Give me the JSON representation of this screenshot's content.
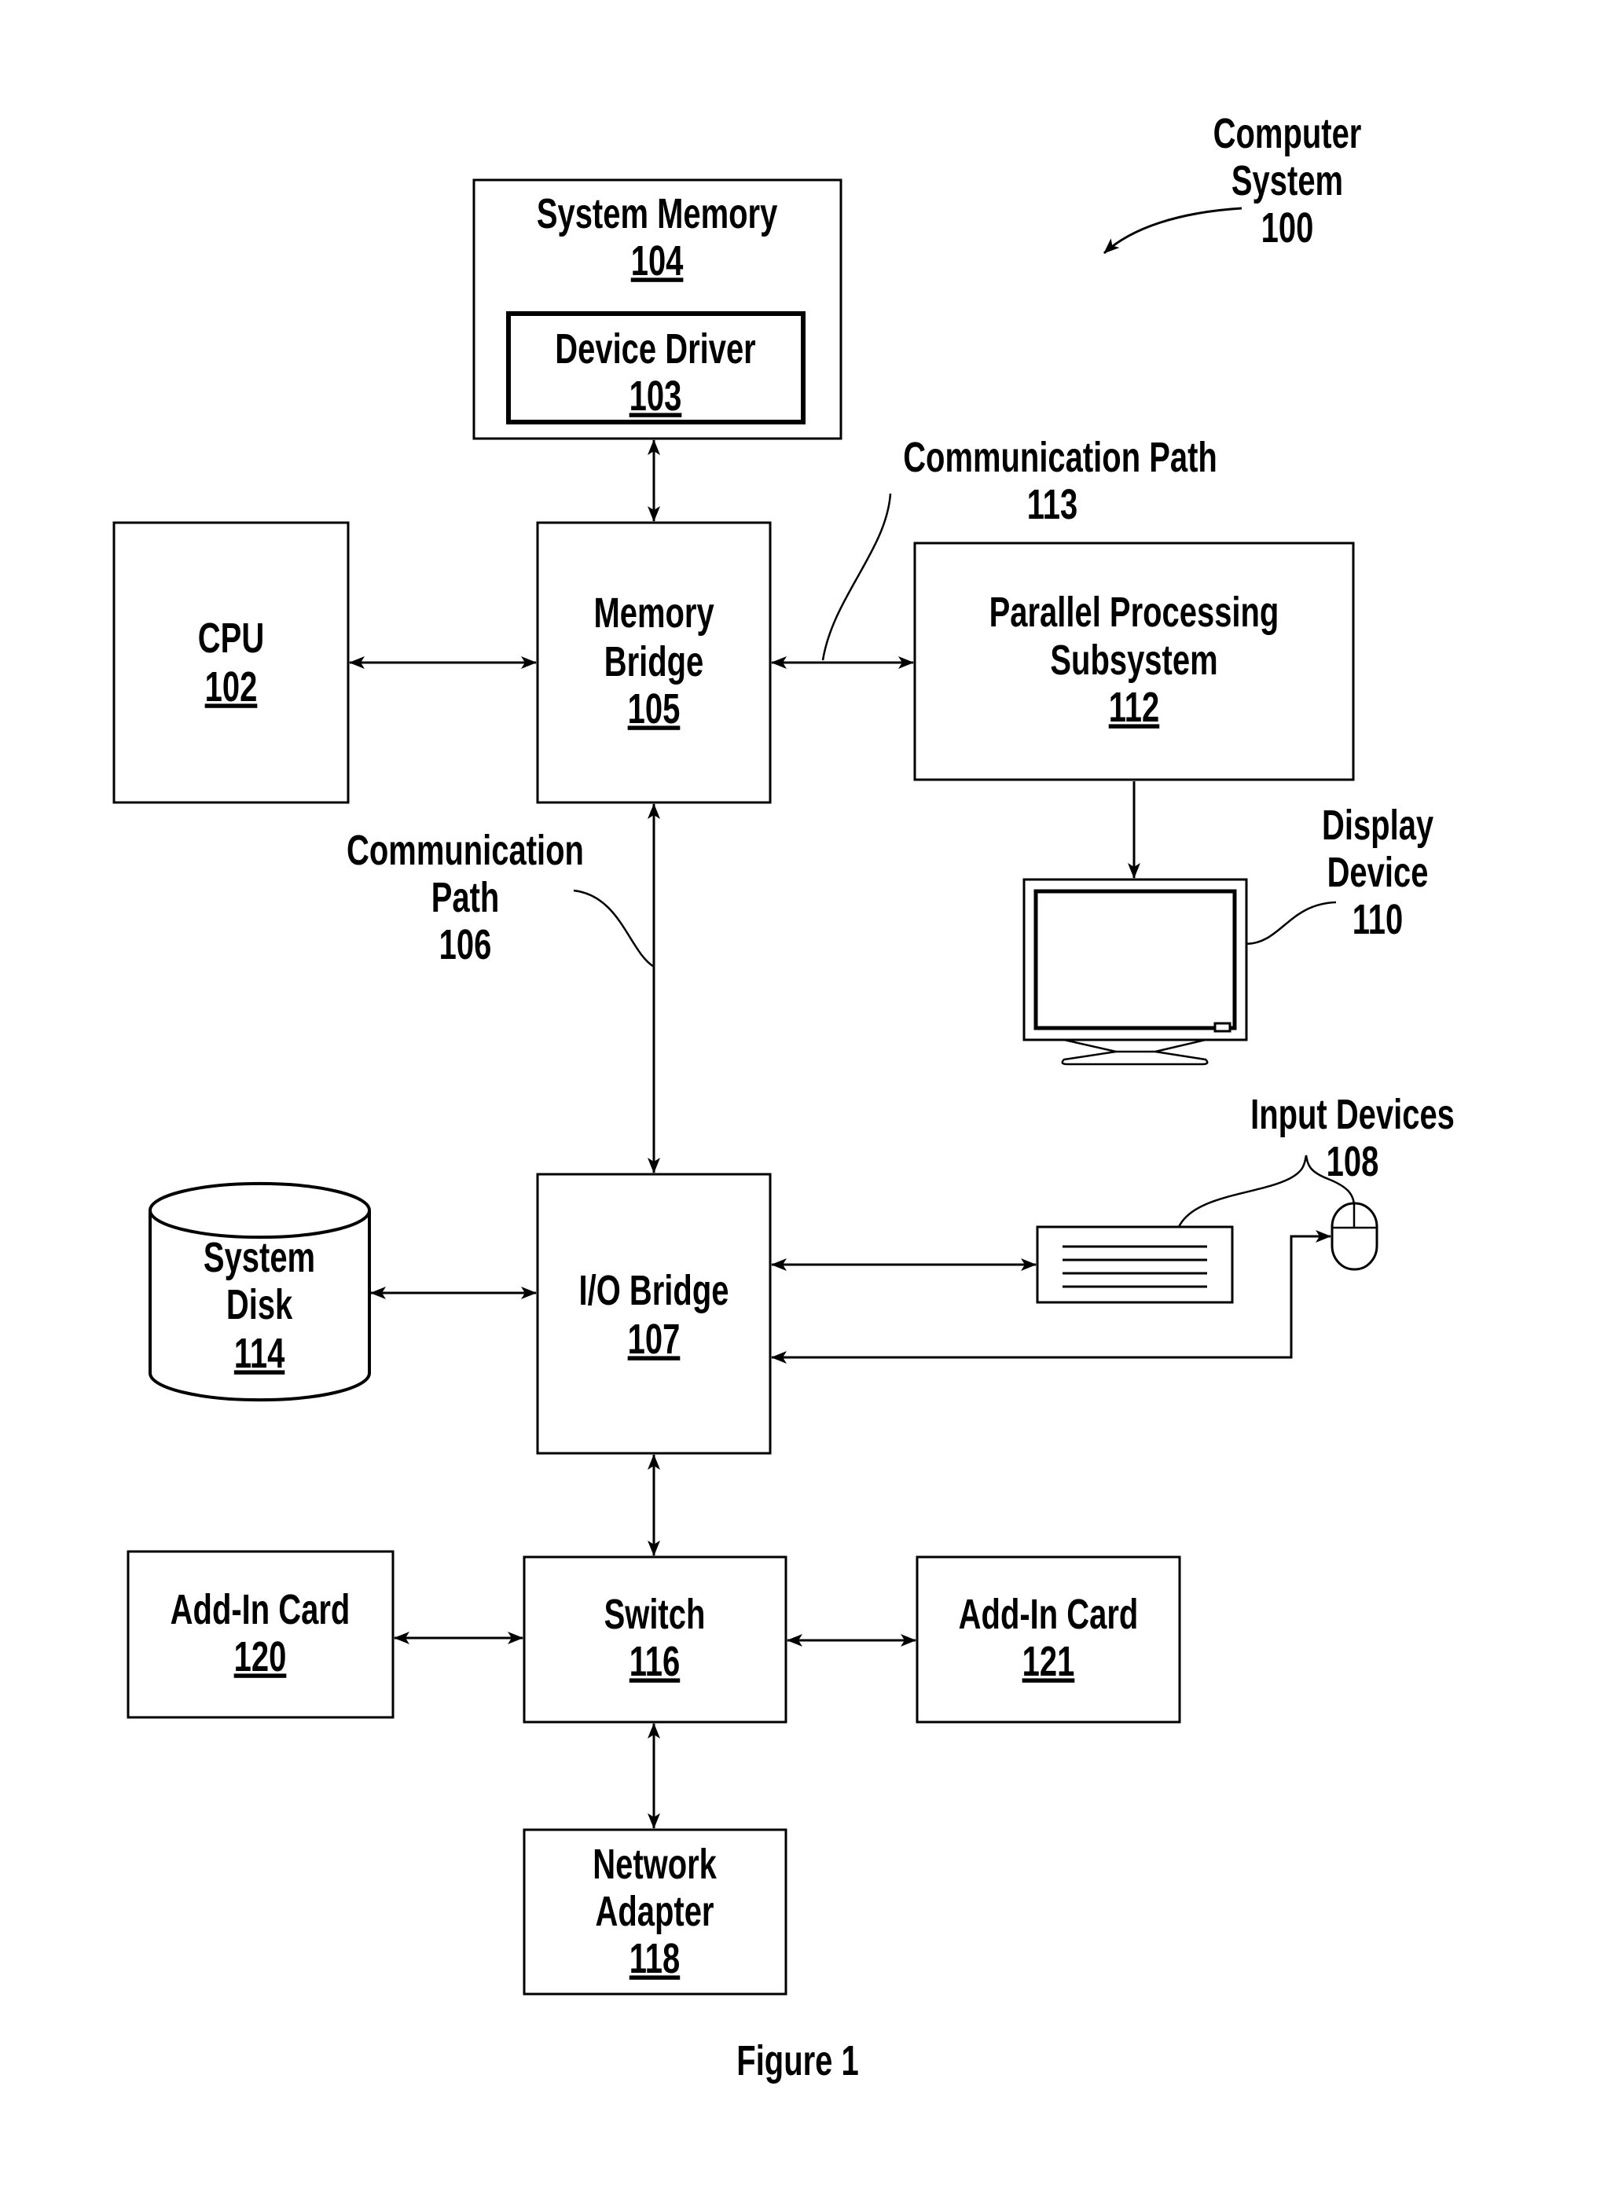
{
  "figure": {
    "caption": "Figure 1",
    "title": {
      "line1": "Computer",
      "line2": "System",
      "ref": "100"
    }
  },
  "components": {
    "system_memory": {
      "label": "System Memory",
      "ref": "104"
    },
    "device_driver": {
      "label": "Device Driver",
      "ref": "103"
    },
    "cpu": {
      "label": "CPU",
      "ref": "102"
    },
    "memory_bridge": {
      "line1": "Memory",
      "line2": "Bridge",
      "ref": "105"
    },
    "parallel_processing": {
      "line1": "Parallel Processing",
      "line2": "Subsystem",
      "ref": "112"
    },
    "display_device": {
      "line1": "Display",
      "line2": "Device",
      "ref": "110"
    },
    "io_bridge": {
      "label": "I/O Bridge",
      "ref": "107"
    },
    "system_disk": {
      "line1": "System",
      "line2": "Disk",
      "ref": "114"
    },
    "input_devices": {
      "label": "Input Devices",
      "ref": "108"
    },
    "switch": {
      "label": "Switch",
      "ref": "116"
    },
    "add_in_card_a": {
      "label": "Add-In Card",
      "ref": "120"
    },
    "add_in_card_b": {
      "label": "Add-In Card",
      "ref": "121"
    },
    "network_adapter": {
      "line1": "Network",
      "line2": "Adapter",
      "ref": "118"
    }
  },
  "paths": {
    "path_113": {
      "line1": "Communication Path",
      "line2": "113"
    },
    "path_106": {
      "line1": "Communication",
      "line2": "Path",
      "line3": "106"
    }
  },
  "connections": [
    {
      "from": "system_memory",
      "to": "memory_bridge",
      "type": "bidirectional"
    },
    {
      "from": "cpu",
      "to": "memory_bridge",
      "type": "bidirectional"
    },
    {
      "from": "memory_bridge",
      "to": "parallel_processing",
      "type": "bidirectional",
      "via": "path_113"
    },
    {
      "from": "parallel_processing",
      "to": "display_device",
      "type": "directed"
    },
    {
      "from": "memory_bridge",
      "to": "io_bridge",
      "type": "bidirectional",
      "via": "path_106"
    },
    {
      "from": "system_disk",
      "to": "io_bridge",
      "type": "bidirectional"
    },
    {
      "from": "io_bridge",
      "to": "keyboard",
      "type": "bidirectional"
    },
    {
      "from": "io_bridge",
      "to": "mouse",
      "type": "bidirectional"
    },
    {
      "from": "io_bridge",
      "to": "switch",
      "type": "bidirectional"
    },
    {
      "from": "add_in_card_a",
      "to": "switch",
      "type": "bidirectional"
    },
    {
      "from": "switch",
      "to": "add_in_card_b",
      "type": "bidirectional"
    },
    {
      "from": "switch",
      "to": "network_adapter",
      "type": "bidirectional"
    }
  ]
}
